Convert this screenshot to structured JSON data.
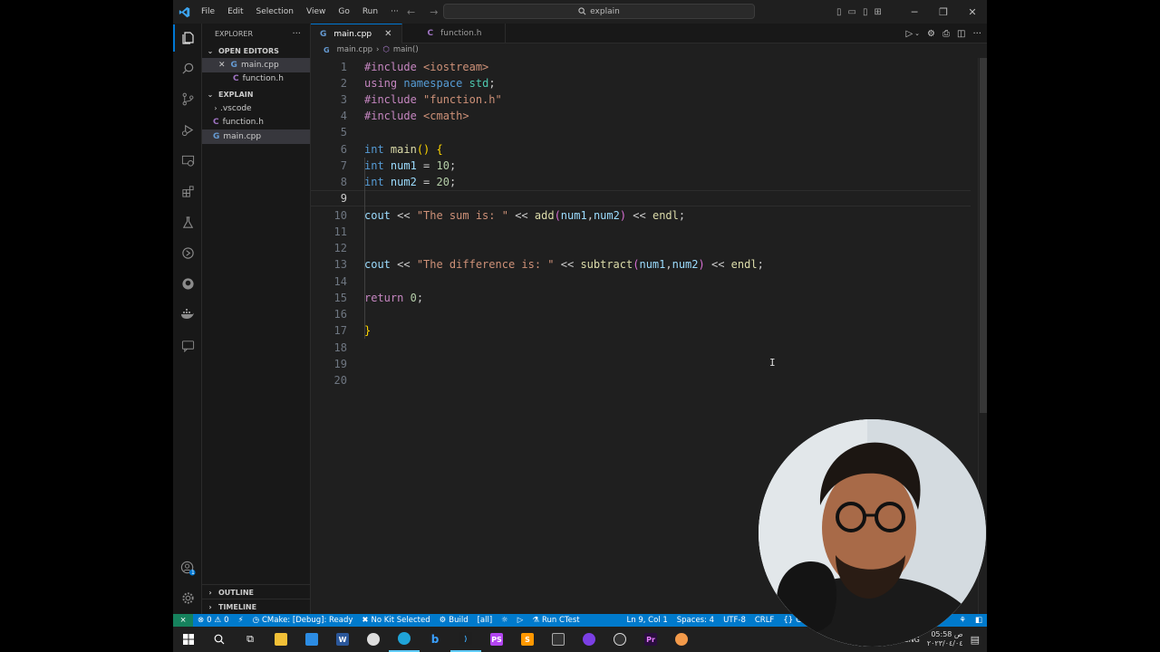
{
  "titlebar": {
    "menu": [
      "File",
      "Edit",
      "Selection",
      "View",
      "Go",
      "Run",
      "···"
    ],
    "search_text": "explain"
  },
  "sidebar": {
    "explorer_label": "EXPLORER",
    "more": "···",
    "open_editors_label": "OPEN EDITORS",
    "open_editors": [
      {
        "name": "main.cpp",
        "icon": "G"
      },
      {
        "name": "function.h",
        "icon": "C"
      }
    ],
    "project_label": "EXPLAIN",
    "files": [
      {
        "name": ".vscode",
        "type": "folder"
      },
      {
        "name": "function.h",
        "type": "file",
        "icon": "C"
      },
      {
        "name": "main.cpp",
        "type": "file",
        "icon": "G",
        "selected": true
      }
    ],
    "outline_label": "OUTLINE",
    "timeline_label": "TIMELINE"
  },
  "editor": {
    "tabs": [
      {
        "name": "main.cpp",
        "icon": "G",
        "active": true
      },
      {
        "name": "function.h",
        "icon": "C",
        "active": false
      }
    ],
    "breadcrumb": [
      "main.cpp",
      "main()"
    ],
    "current_line": 9,
    "lines": [
      "#include <iostream>",
      "using namespace std;",
      "#include \"function.h\"",
      "#include <cmath>",
      "",
      "int main() {",
      "int num1 = 10;",
      "int num2 = 20;",
      "",
      "cout << \"The sum is: \" << add(num1,num2) << endl;",
      "",
      "",
      "cout << \"The difference is: \" << subtract(num1,num2) << endl;",
      "",
      "return 0;",
      "",
      "}",
      "",
      "",
      ""
    ]
  },
  "statusbar": {
    "errors": "0",
    "warnings": "0",
    "cmake": "CMake: [Debug]: Ready",
    "kit": "No Kit Selected",
    "build": "Build",
    "target": "[all]",
    "run_ctest": "Run CTest",
    "position": "Ln 9, Col 1",
    "spaces": "Spaces: 4",
    "encoding": "UTF-8",
    "eol": "CRLF",
    "language": "C++"
  },
  "taskbar": {
    "language": "ENG",
    "time": "05:58 ص",
    "date": "٢٠٢٣/٠٤/٠٤"
  },
  "accounts_badge": "1"
}
